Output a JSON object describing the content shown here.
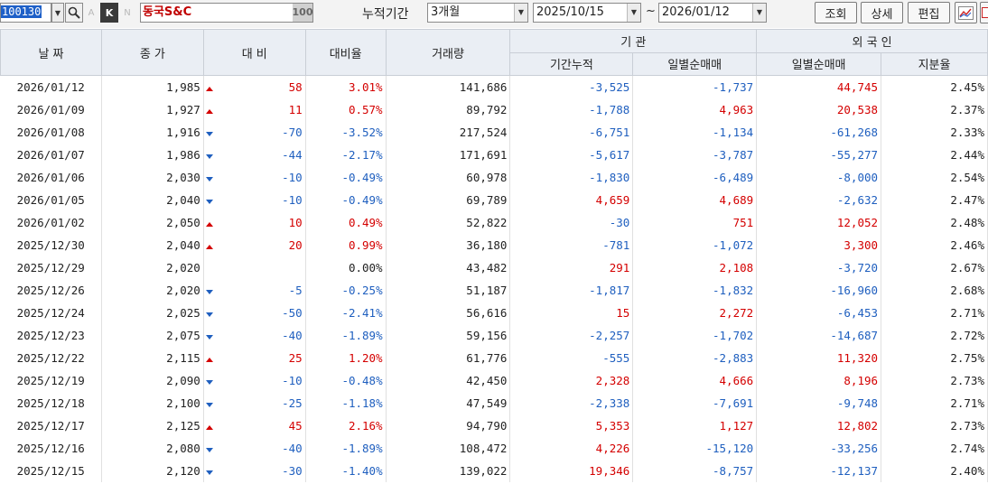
{
  "toolbar": {
    "code": "100130",
    "faded_letters": [
      "A",
      "N"
    ],
    "k_label": "K",
    "stock_name": "동국S&C",
    "badge": "100",
    "period_label": "누적기간",
    "period_value": "3개월",
    "start_date": "2025/10/15",
    "tilde": "~",
    "end_date": "2026/01/12",
    "btn_query": "조회",
    "btn_detail": "상세",
    "btn_edit": "편집",
    "colors": {
      "up": "#d40000",
      "down": "#1f5fbf",
      "name": "#c00000",
      "header_bg": "#eaeef4"
    }
  },
  "headers": {
    "date": "날 짜",
    "close": "종 가",
    "change": "대 비",
    "rate": "대비율",
    "volume": "거래량",
    "inst": "기 관",
    "inst_cum": "기간누적",
    "inst_daily": "일별순매매",
    "foreign": "외 국 인",
    "foreign_daily": "일별순매매",
    "foreign_ratio": "지분율"
  },
  "rows": [
    {
      "date": "2026/01/12",
      "close": "1,985",
      "dir": "up",
      "change": "58",
      "rate": "3.01%",
      "volume": "141,686",
      "inst_cum": "-3,525",
      "inst_daily": "-1,737",
      "foreign_daily": "44,745",
      "ratio": "2.45%"
    },
    {
      "date": "2026/01/09",
      "close": "1,927",
      "dir": "up",
      "change": "11",
      "rate": "0.57%",
      "volume": "89,792",
      "inst_cum": "-1,788",
      "inst_daily": "4,963",
      "foreign_daily": "20,538",
      "ratio": "2.37%"
    },
    {
      "date": "2026/01/08",
      "close": "1,916",
      "dir": "dn",
      "change": "-70",
      "rate": "-3.52%",
      "volume": "217,524",
      "inst_cum": "-6,751",
      "inst_daily": "-1,134",
      "foreign_daily": "-61,268",
      "ratio": "2.33%"
    },
    {
      "date": "2026/01/07",
      "close": "1,986",
      "dir": "dn",
      "change": "-44",
      "rate": "-2.17%",
      "volume": "171,691",
      "inst_cum": "-5,617",
      "inst_daily": "-3,787",
      "foreign_daily": "-55,277",
      "ratio": "2.44%"
    },
    {
      "date": "2026/01/06",
      "close": "2,030",
      "dir": "dn",
      "change": "-10",
      "rate": "-0.49%",
      "volume": "60,978",
      "inst_cum": "-1,830",
      "inst_daily": "-6,489",
      "foreign_daily": "-8,000",
      "ratio": "2.54%"
    },
    {
      "date": "2026/01/05",
      "close": "2,040",
      "dir": "dn",
      "change": "-10",
      "rate": "-0.49%",
      "volume": "69,789",
      "inst_cum": "4,659",
      "inst_daily": "4,689",
      "foreign_daily": "-2,632",
      "ratio": "2.47%"
    },
    {
      "date": "2026/01/02",
      "close": "2,050",
      "dir": "up",
      "change": "10",
      "rate": "0.49%",
      "volume": "52,822",
      "inst_cum": "-30",
      "inst_daily": "751",
      "foreign_daily": "12,052",
      "ratio": "2.48%"
    },
    {
      "date": "2025/12/30",
      "close": "2,040",
      "dir": "up",
      "change": "20",
      "rate": "0.99%",
      "volume": "36,180",
      "inst_cum": "-781",
      "inst_daily": "-1,072",
      "foreign_daily": "3,300",
      "ratio": "2.46%"
    },
    {
      "date": "2025/12/29",
      "close": "2,020",
      "dir": "flat",
      "change": "",
      "rate": "0.00%",
      "volume": "43,482",
      "inst_cum": "291",
      "inst_daily": "2,108",
      "foreign_daily": "-3,720",
      "ratio": "2.67%"
    },
    {
      "date": "2025/12/26",
      "close": "2,020",
      "dir": "dn",
      "change": "-5",
      "rate": "-0.25%",
      "volume": "51,187",
      "inst_cum": "-1,817",
      "inst_daily": "-1,832",
      "foreign_daily": "-16,960",
      "ratio": "2.68%"
    },
    {
      "date": "2025/12/24",
      "close": "2,025",
      "dir": "dn",
      "change": "-50",
      "rate": "-2.41%",
      "volume": "56,616",
      "inst_cum": "15",
      "inst_daily": "2,272",
      "foreign_daily": "-6,453",
      "ratio": "2.71%"
    },
    {
      "date": "2025/12/23",
      "close": "2,075",
      "dir": "dn",
      "change": "-40",
      "rate": "-1.89%",
      "volume": "59,156",
      "inst_cum": "-2,257",
      "inst_daily": "-1,702",
      "foreign_daily": "-14,687",
      "ratio": "2.72%"
    },
    {
      "date": "2025/12/22",
      "close": "2,115",
      "dir": "up",
      "change": "25",
      "rate": "1.20%",
      "volume": "61,776",
      "inst_cum": "-555",
      "inst_daily": "-2,883",
      "foreign_daily": "11,320",
      "ratio": "2.75%"
    },
    {
      "date": "2025/12/19",
      "close": "2,090",
      "dir": "dn",
      "change": "-10",
      "rate": "-0.48%",
      "volume": "42,450",
      "inst_cum": "2,328",
      "inst_daily": "4,666",
      "foreign_daily": "8,196",
      "ratio": "2.73%"
    },
    {
      "date": "2025/12/18",
      "close": "2,100",
      "dir": "dn",
      "change": "-25",
      "rate": "-1.18%",
      "volume": "47,549",
      "inst_cum": "-2,338",
      "inst_daily": "-7,691",
      "foreign_daily": "-9,748",
      "ratio": "2.71%"
    },
    {
      "date": "2025/12/17",
      "close": "2,125",
      "dir": "up",
      "change": "45",
      "rate": "2.16%",
      "volume": "94,790",
      "inst_cum": "5,353",
      "inst_daily": "1,127",
      "foreign_daily": "12,802",
      "ratio": "2.73%"
    },
    {
      "date": "2025/12/16",
      "close": "2,080",
      "dir": "dn",
      "change": "-40",
      "rate": "-1.89%",
      "volume": "108,472",
      "inst_cum": "4,226",
      "inst_daily": "-15,120",
      "foreign_daily": "-33,256",
      "ratio": "2.74%"
    },
    {
      "date": "2025/12/15",
      "close": "2,120",
      "dir": "dn",
      "change": "-30",
      "rate": "-1.40%",
      "volume": "139,022",
      "inst_cum": "19,346",
      "inst_daily": "-8,757",
      "foreign_daily": "-12,137",
      "ratio": "2.40%"
    }
  ]
}
